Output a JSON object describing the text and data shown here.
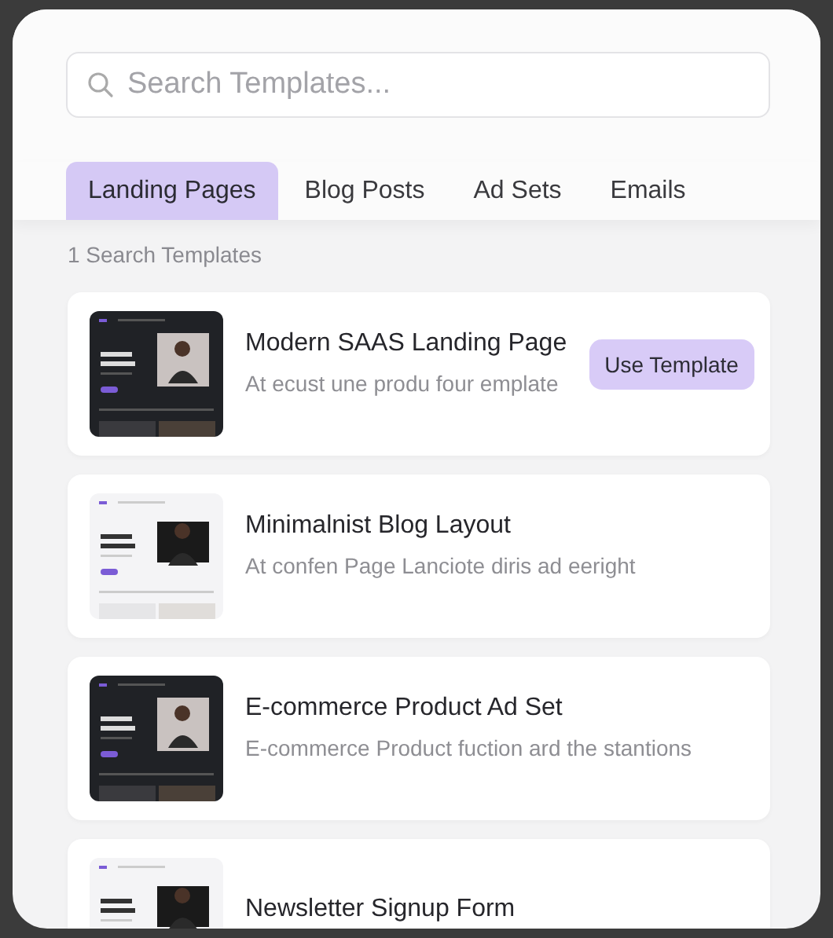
{
  "search": {
    "placeholder": "Search Templates..."
  },
  "tabs": [
    {
      "label": "Landing Pages",
      "selected": true
    },
    {
      "label": "Blog Posts",
      "selected": false
    },
    {
      "label": "Ad Sets",
      "selected": false
    },
    {
      "label": "Emails",
      "selected": false
    }
  ],
  "result_count": "1 Search Templates",
  "templates": [
    {
      "title": "Modern SAAS Landing Page",
      "description": "At ecust une produ four emplate",
      "button": "Use Template"
    },
    {
      "title": "Minimalnist Blog Layout",
      "description": "At confen Page Lanciote diris ad eeright"
    },
    {
      "title": "E-commerce Product Ad Set",
      "description": "E-commerce Product fuction ard the stantions"
    },
    {
      "title": "Newsletter Signup Form"
    }
  ]
}
